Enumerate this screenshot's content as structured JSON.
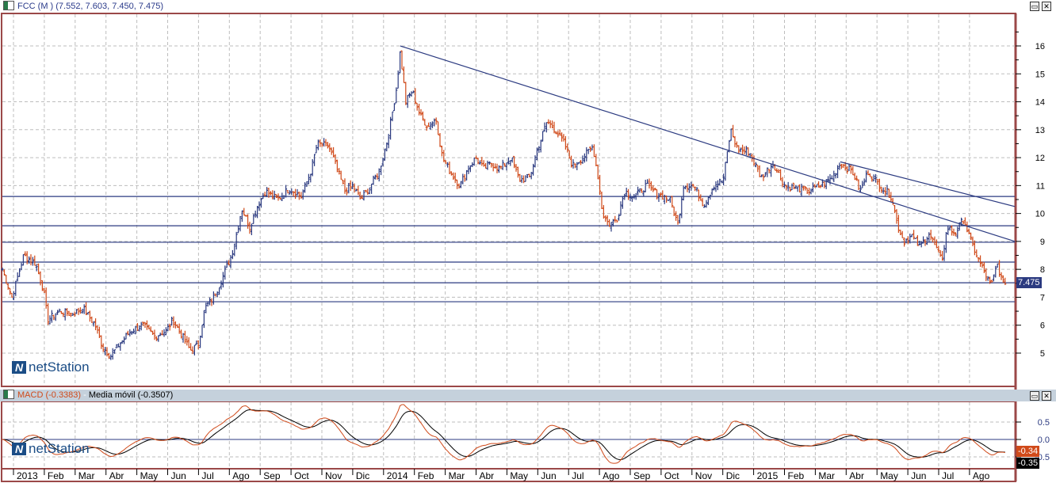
{
  "window": {
    "title": "FCC (M ) (7.552, 7.603, 7.450, 7.475)",
    "logo_text": "netStation",
    "buttons": [
      "restore",
      "close"
    ]
  },
  "macd_panel": {
    "macd_label": "MACD (-0.3383)",
    "separator": " - ",
    "sma_label": "Media móvil (-0.3507)",
    "macd_value_tag": "-0.34",
    "signal_value_tag": "-0.35"
  },
  "colors": {
    "up": "#2b3a80",
    "down": "#d04a1a",
    "border": "#9b4848",
    "grid": "#bdbdbd",
    "lines": "#2b3a80"
  },
  "chart_data": [
    {
      "type": "line",
      "title": "FCC (M )",
      "subtitle": "(7.552, 7.603, 7.450, 7.475)",
      "x_unit": "months since Jan 2013",
      "last_price": "7.475",
      "ylim": [
        4,
        17
      ],
      "yticks": [
        5,
        6,
        7,
        8,
        9,
        10,
        11,
        12,
        13,
        14,
        15,
        16
      ],
      "xticks": [
        {
          "m": 0,
          "label": "2013"
        },
        {
          "m": 1,
          "label": "Feb"
        },
        {
          "m": 2,
          "label": "Mar"
        },
        {
          "m": 3,
          "label": "Abr"
        },
        {
          "m": 4,
          "label": "May"
        },
        {
          "m": 5,
          "label": "Jun"
        },
        {
          "m": 6,
          "label": "Jul"
        },
        {
          "m": 7,
          "label": "Ago"
        },
        {
          "m": 8,
          "label": "Sep"
        },
        {
          "m": 9,
          "label": "Oct"
        },
        {
          "m": 10,
          "label": "Nov"
        },
        {
          "m": 11,
          "label": "Dic"
        },
        {
          "m": 12,
          "label": "2014"
        },
        {
          "m": 13,
          "label": "Feb"
        },
        {
          "m": 14,
          "label": "Mar"
        },
        {
          "m": 15,
          "label": "Abr"
        },
        {
          "m": 16,
          "label": "May"
        },
        {
          "m": 17,
          "label": "Jun"
        },
        {
          "m": 18,
          "label": "Jul"
        },
        {
          "m": 19,
          "label": "Ago"
        },
        {
          "m": 20,
          "label": "Sep"
        },
        {
          "m": 21,
          "label": "Oct"
        },
        {
          "m": 22,
          "label": "Nov"
        },
        {
          "m": 23,
          "label": "Dic"
        },
        {
          "m": 24,
          "label": "2015"
        },
        {
          "m": 25,
          "label": "Feb"
        },
        {
          "m": 26,
          "label": "Mar"
        },
        {
          "m": 27,
          "label": "Abr"
        },
        {
          "m": 28,
          "label": "May"
        },
        {
          "m": 29,
          "label": "Jun"
        },
        {
          "m": 30,
          "label": "Jul"
        },
        {
          "m": 31,
          "label": "Ago"
        }
      ],
      "price": [
        [
          -0.36,
          8.0
        ],
        [
          -0.05,
          7.0
        ],
        [
          0.33,
          8.5
        ],
        [
          0.72,
          8.2
        ],
        [
          0.98,
          7.2
        ],
        [
          1.11,
          6.2
        ],
        [
          1.49,
          6.5
        ],
        [
          1.88,
          6.4
        ],
        [
          2.26,
          6.6
        ],
        [
          2.65,
          6.0
        ],
        [
          2.9,
          5.2
        ],
        [
          3.16,
          4.9
        ],
        [
          3.42,
          5.3
        ],
        [
          3.8,
          5.8
        ],
        [
          4.19,
          6.0
        ],
        [
          4.58,
          5.6
        ],
        [
          4.96,
          5.8
        ],
        [
          5.17,
          6.2
        ],
        [
          5.48,
          5.6
        ],
        [
          5.73,
          5.1
        ],
        [
          5.99,
          5.3
        ],
        [
          6.2,
          6.6
        ],
        [
          6.5,
          7.0
        ],
        [
          6.81,
          7.8
        ],
        [
          7.07,
          8.5
        ],
        [
          7.28,
          9.5
        ],
        [
          7.4,
          10.2
        ],
        [
          7.66,
          9.5
        ],
        [
          7.92,
          10.3
        ],
        [
          8.17,
          10.8
        ],
        [
          8.56,
          10.5
        ],
        [
          8.95,
          10.9
        ],
        [
          9.33,
          10.6
        ],
        [
          9.64,
          11.5
        ],
        [
          9.85,
          12.5
        ],
        [
          10.23,
          12.4
        ],
        [
          10.49,
          11.6
        ],
        [
          10.75,
          10.8
        ],
        [
          11.0,
          11.0
        ],
        [
          11.26,
          10.5
        ],
        [
          11.52,
          10.9
        ],
        [
          11.85,
          11.5
        ],
        [
          12.16,
          12.8
        ],
        [
          12.42,
          14.5
        ],
        [
          12.54,
          15.8
        ],
        [
          12.72,
          14.0
        ],
        [
          12.93,
          14.4
        ],
        [
          13.19,
          13.5
        ],
        [
          13.44,
          13.1
        ],
        [
          13.7,
          13.4
        ],
        [
          13.91,
          12.0
        ],
        [
          14.16,
          11.5
        ],
        [
          14.47,
          11.0
        ],
        [
          14.73,
          11.6
        ],
        [
          14.99,
          12.0
        ],
        [
          15.24,
          11.6
        ],
        [
          15.5,
          11.8
        ],
        [
          15.76,
          11.6
        ],
        [
          16.14,
          12.0
        ],
        [
          16.4,
          11.2
        ],
        [
          16.74,
          11.3
        ],
        [
          16.99,
          12.3
        ],
        [
          17.3,
          13.3
        ],
        [
          17.56,
          13.0
        ],
        [
          17.87,
          12.5
        ],
        [
          18.12,
          11.7
        ],
        [
          18.46,
          12.0
        ],
        [
          18.79,
          12.4
        ],
        [
          18.97,
          11.2
        ],
        [
          19.1,
          10.0
        ],
        [
          19.31,
          9.6
        ],
        [
          19.56,
          9.8
        ],
        [
          19.82,
          10.8
        ],
        [
          20.13,
          10.6
        ],
        [
          20.51,
          11.0
        ],
        [
          20.9,
          10.7
        ],
        [
          21.29,
          10.5
        ],
        [
          21.54,
          9.6
        ],
        [
          21.72,
          11.0
        ],
        [
          22.06,
          11.0
        ],
        [
          22.39,
          10.3
        ],
        [
          22.7,
          11.0
        ],
        [
          23.01,
          11.2
        ],
        [
          23.26,
          13.0
        ],
        [
          23.47,
          12.3
        ],
        [
          23.86,
          12.2
        ],
        [
          24.24,
          11.3
        ],
        [
          24.63,
          11.8
        ],
        [
          25.01,
          11.0
        ],
        [
          25.4,
          10.9
        ],
        [
          25.78,
          10.8
        ],
        [
          26.17,
          11.0
        ],
        [
          26.56,
          11.3
        ],
        [
          26.81,
          11.8
        ],
        [
          27.2,
          11.5
        ],
        [
          27.46,
          10.8
        ],
        [
          27.71,
          11.5
        ],
        [
          28.1,
          11.0
        ],
        [
          28.48,
          10.6
        ],
        [
          28.66,
          9.6
        ],
        [
          28.87,
          9.0
        ],
        [
          29.13,
          9.2
        ],
        [
          29.38,
          8.8
        ],
        [
          29.69,
          9.3
        ],
        [
          29.9,
          8.8
        ],
        [
          30.1,
          8.3
        ],
        [
          30.28,
          9.5
        ],
        [
          30.54,
          9.3
        ],
        [
          30.8,
          9.8
        ],
        [
          31.05,
          9.0
        ],
        [
          31.31,
          8.3
        ],
        [
          31.57,
          7.7
        ],
        [
          31.7,
          7.4
        ],
        [
          31.9,
          8.2
        ],
        [
          32.08,
          7.5
        ],
        [
          32.21,
          7.475
        ]
      ],
      "horizontal_lines": [
        10.61,
        9.56,
        8.97,
        8.26,
        7.52,
        6.84
      ],
      "trendlines": [
        [
          [
            12.54,
            16.0
          ],
          [
            32.47,
            9.0
          ]
        ],
        [
          [
            26.81,
            11.85
          ],
          [
            32.47,
            10.25
          ]
        ]
      ]
    },
    {
      "type": "line",
      "title": "MACD",
      "series": [
        {
          "name": "MACD",
          "last": -0.3383
        },
        {
          "name": "Media móvil",
          "last": -0.3507
        }
      ],
      "ylim": [
        -0.85,
        1.1
      ],
      "yticks": [
        {
          "v": 0.5,
          "label": "0.5"
        },
        {
          "v": 0.0,
          "label": "0.0"
        },
        {
          "v": -0.5,
          "label": "-0.5"
        }
      ]
    }
  ]
}
